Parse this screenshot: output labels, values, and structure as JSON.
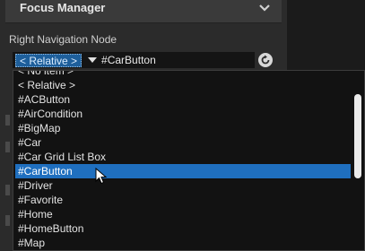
{
  "section": {
    "title": "Focus Manager",
    "icon": "chevron-down-icon"
  },
  "property": {
    "label": "Right Navigation Node",
    "chip": "< Relative >",
    "value": "#CarButton",
    "action_icon": "circular-arrow-icon"
  },
  "dropdown": {
    "items": [
      "< No item >",
      "< Relative >",
      "#ACButton",
      "#AirCondition",
      "#BigMap",
      "#Car",
      "#Car Grid List Box",
      "#CarButton",
      "#Driver",
      "#Favorite",
      "#Home",
      "#HomeButton",
      "#Map"
    ],
    "selected_index": 7
  },
  "colors": {
    "selection": "#1f6fbf",
    "chip": "#1e5f9b",
    "panel": "#2b2b2b",
    "list_background": "#121212"
  }
}
